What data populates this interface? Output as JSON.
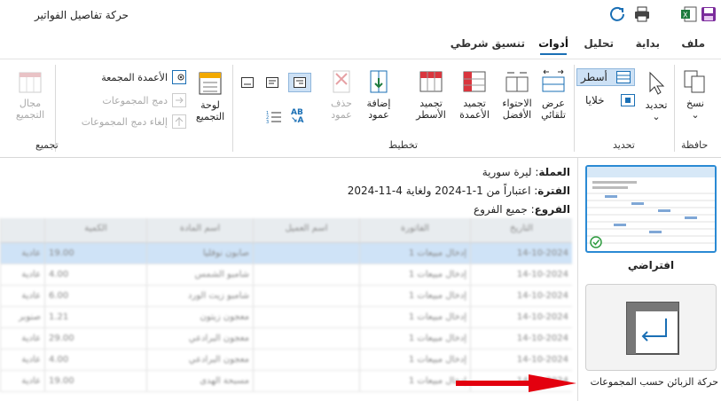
{
  "window": {
    "title": "حركة تفاصيل الفواتير"
  },
  "tabs": [
    {
      "label": "ملف"
    },
    {
      "label": "بداية"
    },
    {
      "label": "تحليل"
    },
    {
      "label": "أدوات"
    },
    {
      "label": "تنسيق شرطي"
    }
  ],
  "ribbon": {
    "clipboard": {
      "label": "حافظة",
      "copy": "نسخ"
    },
    "selection": {
      "label": "تحديد",
      "select": "تحديد",
      "rows": "أسطر",
      "cells": "خلايا"
    },
    "layout": {
      "label": "تخطيط",
      "autofit_width": "عرض تلقائي",
      "best_fit": "الاحتواء الأفضل",
      "freeze_cols": "تجميد الأعمدة",
      "freeze_rows": "تجميد الأسطر",
      "add_column": "إضافة عمود",
      "delete_column": "حذف عمود"
    },
    "grouping": {
      "label": "تجميع",
      "group_panel": "لوحة التجميع",
      "grouped_columns": "الأعمدة المجمعة",
      "merge_groups": "دمج المجموعات",
      "unmerge_groups": "إلغاء دمج المجموعات",
      "group_range": "مجال التجميع"
    }
  },
  "report_info": {
    "currency_label": "العملة",
    "currency_value": ": ليرة سورية",
    "period_label": "الفترة",
    "period_value": ": اعتباراً من 1-1-2024 ولغاية 4-11-2024",
    "branches_label": "الفروع",
    "branches_value": ": جميع الفروع"
  },
  "grid": {
    "columns": [
      "التاريخ",
      "الفاتورة",
      "اسم العميل",
      "اسم المادة",
      "الكمية",
      ""
    ],
    "rows": [
      [
        "14-10-2024",
        "إدخال مبيعات 1",
        "",
        "صابون نوفليا",
        "19.00",
        "عادية"
      ],
      [
        "14-10-2024",
        "إدخال مبيعات 1",
        "",
        "شامبو الشمس",
        "4.00",
        "عادية"
      ],
      [
        "14-10-2024",
        "إدخال مبيعات 1",
        "",
        "شامبو زيت الورد",
        "6.00",
        "عادية"
      ],
      [
        "14-10-2024",
        "إدخال مبيعات 1",
        "",
        "معجون زيتون",
        "1.21",
        "صنوبر"
      ],
      [
        "14-10-2024",
        "إدخال مبيعات 1",
        "",
        "معجون البرادعي",
        "29.00",
        "عادية"
      ],
      [
        "14-10-2024",
        "إدخال مبيعات 1",
        "",
        "معجون البرادعي",
        "4.00",
        "عادية"
      ],
      [
        "14-10-2024",
        "إدخال مبيعات 1",
        "",
        "مسبحة الهدى",
        "19.00",
        "عادية"
      ]
    ]
  },
  "side_panel": {
    "default_label": "افتراضي",
    "customers_label": "حركة الزبائن حسب المجموعات"
  },
  "colors": {
    "accent": "#1a6fb5",
    "arrow": "#e3000f",
    "selection": "#cfe3f7",
    "thumb_border": "#2a8ad4"
  }
}
